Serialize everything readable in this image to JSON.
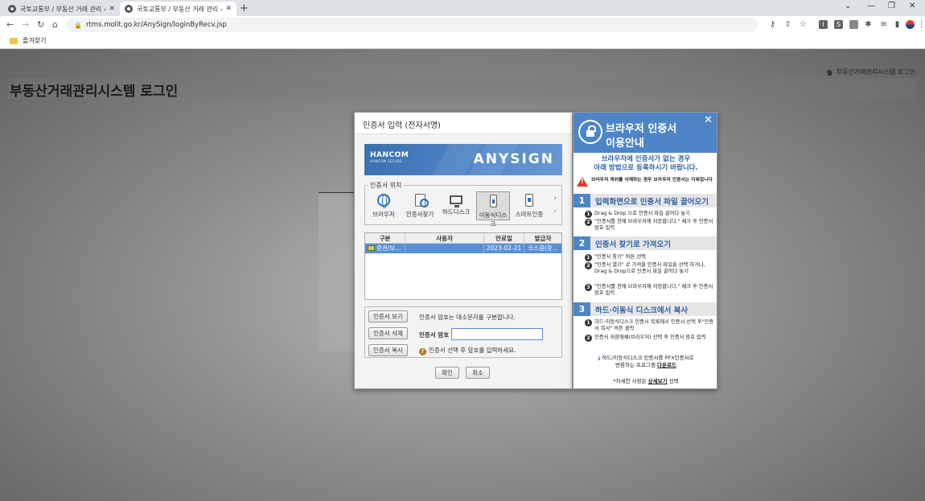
{
  "browser": {
    "tabs": [
      {
        "title": "국토교통부 / 부동산 거래 관리 시",
        "close": "✕"
      },
      {
        "title": "국토교통부 / 부동산 거래 관리 시",
        "close": "✕"
      }
    ],
    "new_tab": "+",
    "window_controls": [
      "⌄",
      "—",
      "❐",
      "✕"
    ],
    "url": "rtms.molit.go.kr/AnySign/loginByRecv.jsp",
    "bookmark": "즐겨찾기"
  },
  "page": {
    "breadcrumb": "부동산거래관리시스템 로그인",
    "title": "부동산거래관리시스템 로그인"
  },
  "dialog": {
    "title": "인증서 입력 (전자서명)",
    "banner": {
      "brand": "HANCOM",
      "brand_sub": "HANCOM SECURE",
      "product": "ANYSIGN"
    },
    "location_legend": "인증서 위치",
    "locations": [
      {
        "label": "브라우저",
        "icon": "globe-icon"
      },
      {
        "label": "인증서찾기",
        "icon": "find-cert-icon"
      },
      {
        "label": "하드디스크",
        "icon": "monitor-icon"
      },
      {
        "label": "이동식디스크",
        "icon": "usb-icon"
      },
      {
        "label": "스마트인증",
        "icon": "smartphone-icon"
      }
    ],
    "selected_location": "이동식디스크",
    "table": {
      "headers": [
        "구분",
        "사용자",
        "만료일",
        "발급자"
      ],
      "rows": [
        {
          "type": "증권/보...",
          "user": "",
          "expiry": "2023-02-21",
          "issuer": "코스콤(증..."
        }
      ]
    },
    "view_cert_button": "인증서 보기",
    "delete_cert_button": "인증서 삭제",
    "copy_cert_button": "인증서 복사",
    "case_note": "인증서 암호는 대소문자를 구분합니다.",
    "password_label": "인증서 암호",
    "password_value": "",
    "select_note": "인증서 선택 후 암호를 입력하세요.",
    "ok_button": "확인",
    "cancel_button": "취소"
  },
  "guide": {
    "title_line1": "브라우저 인증서",
    "title_line2": "이용안내",
    "lead_line1": "브라우저에 인증서가 없는 경우",
    "lead_line2": "아래 방법으로 등록하시기 바랍니다.",
    "warning": "브라우저 캐쉬를 삭제하는 경우 브라우저 인증서는 지워집니다",
    "sections": [
      {
        "num": "1",
        "title": "입력화면으로 인증서 파일 끌어오기",
        "steps": [
          "Drag & Drop 으로 인증서 파일 끌어다 놓기",
          "\"인증서를 현재 브라우저에 저장합니다.\" 체크 후 인증서 암호 입력"
        ]
      },
      {
        "num": "2",
        "title": "인증서 찾기로 가져오기",
        "steps": [
          "\"인증서 찾기\" 버튼 선택",
          "\"인증서 열기\" 로 가져올 인증서 파일을 선택 하거나, Drag & Drop으로 인증서 파일 끌어다 놓기",
          "\"인증서를 현재 브라우저에 저장합니다.\" 체크 후 인증서 암호 입력"
        ]
      },
      {
        "num": "3",
        "title": "하드·이동식 디스크에서 복사",
        "steps": [
          "하드·이동식디스크 인증서 목록에서 인증서 선택 후\"인증서 복사\" 버튼 클릭",
          "인증서 저장매체(브라우저) 선택 후 인증서 암호 입력"
        ]
      }
    ],
    "download_line1": "하드/이동식디스크 인증서를 PFX인증서로",
    "download_line2": "변환하는 프로그램",
    "download_link": "다운로드",
    "note_prefix": "*자세한 사항은",
    "note_link": "상세보기",
    "note_suffix": "선택"
  }
}
